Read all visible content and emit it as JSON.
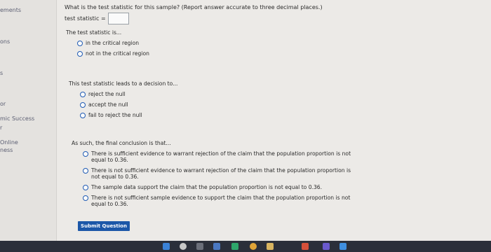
{
  "sidebar": {
    "items": [
      "ements",
      "ons",
      "s",
      "or",
      "mic Success",
      "r",
      "Online",
      "ness"
    ]
  },
  "question": {
    "prompt": "What is the test statistic for this sample? (Report answer accurate to three decimal places.)",
    "test_statistic_label": "test statistic =",
    "test_statistic_value": ""
  },
  "region_block": {
    "prompt": "The test statistic is...",
    "options": [
      "in the critical region",
      "not in the critical region"
    ]
  },
  "decision_block": {
    "prompt": "This test statistic leads to a decision to...",
    "options": [
      "reject the null",
      "accept the null",
      "fail to reject the null"
    ]
  },
  "conclusion_block": {
    "prompt": "As such, the final conclusion is that...",
    "options": [
      "There is sufficient evidence to warrant rejection of the claim that the population proportion is not equal to 0.36.",
      "There is not sufficient evidence to warrant rejection of the claim that the population proportion is not equal to 0.36.",
      "The sample data support the claim that the population proportion is not equal to 0.36.",
      "There is not sufficient sample evidence to support the claim that the population proportion is not equal to 0.36."
    ]
  },
  "submit_label": "Submit Question",
  "taskbar_icons": [
    "windows-icon",
    "search-icon",
    "task-view-icon",
    "app-icon",
    "edge-icon",
    "chrome-icon",
    "files-icon",
    "mail-icon",
    "settings-icon",
    "store-icon"
  ],
  "colors": {
    "background": "#eceae7",
    "accent": "#1c57a8",
    "radio_border": "#1f5bb4",
    "sidebar_text": "#5b5e72",
    "taskbar": "#2b2f3a"
  }
}
